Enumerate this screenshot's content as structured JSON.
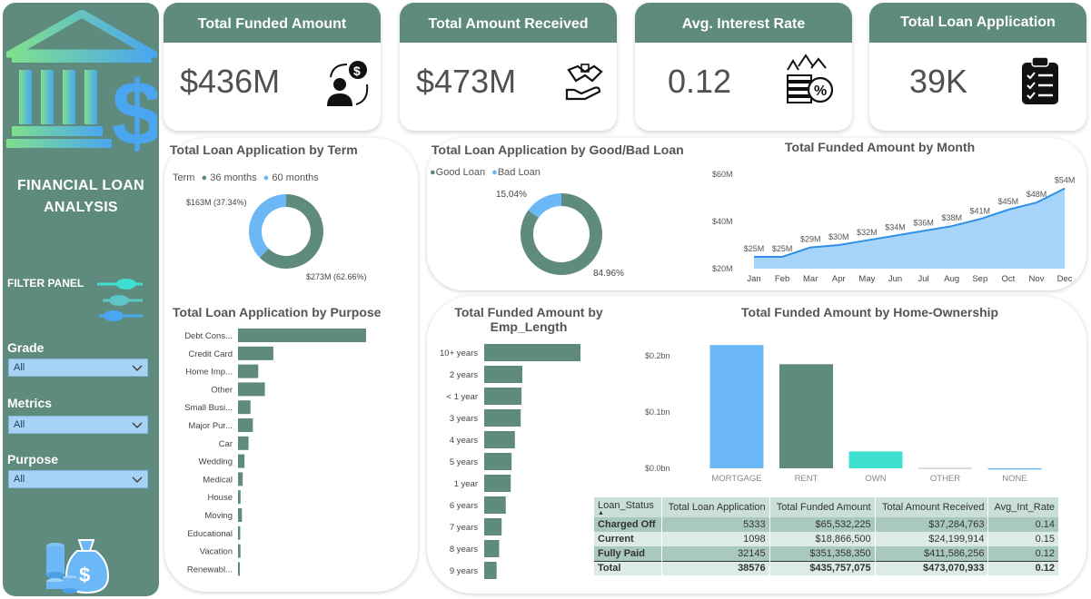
{
  "sidebar": {
    "title_line1": "FINANCIAL LOAN",
    "title_line2": "ANALYSIS",
    "filter_panel": "FILTER PANEL",
    "slicers": [
      {
        "label": "Grade",
        "value": "All"
      },
      {
        "label": "Metrics",
        "value": "All"
      },
      {
        "label": "Purpose",
        "value": "All"
      }
    ]
  },
  "kpis": [
    {
      "title": "Total Funded Amount",
      "value": "$436M",
      "icon": "money-hand-icon"
    },
    {
      "title": "Total Amount Received",
      "value": "$473M",
      "icon": "handshake-icon"
    },
    {
      "title": "Avg. Interest Rate",
      "value": "0.12",
      "icon": "interest-coins-icon"
    },
    {
      "title": "Total Loan Application",
      "value": "39K",
      "icon": "clipboard-checklist-icon"
    }
  ],
  "colors": {
    "teal": "#5f8a7e",
    "blue": "#6cb8f6",
    "turquoise": "#3ee0cf",
    "header": "#5f8a7e"
  },
  "chart_data": [
    {
      "id": "term",
      "type": "pie",
      "title": "Total Loan Application by Term",
      "legend_title": "Term",
      "categories": [
        "36 months",
        "60 months"
      ],
      "values": [
        62.66,
        37.34
      ],
      "labels": [
        "$273M (62.66%)",
        "$163M (37.34%)"
      ]
    },
    {
      "id": "goodbad",
      "type": "pie",
      "title": "Total Loan Application by Good/Bad Loan",
      "categories": [
        "Good Loan",
        "Bad Loan"
      ],
      "values": [
        84.96,
        15.04
      ],
      "labels": [
        "84.96%",
        "15.04%"
      ]
    },
    {
      "id": "month",
      "type": "area",
      "title": "Total Funded Amount by Month",
      "categories": [
        "Jan",
        "Feb",
        "Mar",
        "Apr",
        "May",
        "Jun",
        "Jul",
        "Aug",
        "Sep",
        "Oct",
        "Nov",
        "Dec"
      ],
      "values": [
        25,
        25,
        29,
        30,
        32,
        34,
        36,
        38,
        41,
        45,
        48,
        54
      ],
      "labels": [
        "$25M",
        "$25M",
        "$29M",
        "$30M",
        "$32M",
        "$34M",
        "$36M",
        "$38M",
        "$41M",
        "$45M",
        "$48M",
        "$54M"
      ],
      "yticks": [
        "$20M",
        "$40M",
        "$60M"
      ],
      "ylim": [
        20,
        60
      ]
    },
    {
      "id": "purpose",
      "type": "bar",
      "title": "Total Loan Application by Purpose",
      "categories": [
        "Debt Cons...",
        "Credit Card",
        "Home Imp...",
        "Other",
        "Small Busi...",
        "Major Pur...",
        "Car",
        "Wedding",
        "Medical",
        "House",
        "Moving",
        "Educational",
        "Vacation",
        "Renewabl..."
      ],
      "values": [
        18214,
        5027,
        2876,
        3824,
        1776,
        2110,
        1497,
        928,
        667,
        366,
        559,
        315,
        352,
        94
      ]
    },
    {
      "id": "emp",
      "type": "bar",
      "title_line1": "Total Funded Amount by",
      "title_line2": "Emp_Length",
      "categories": [
        "10+ years",
        "2 years",
        "< 1 year",
        "3 years",
        "4 years",
        "5 years",
        "1 year",
        "6 years",
        "7 years",
        "8 years",
        "9 years"
      ],
      "values": [
        116,
        46,
        45,
        44,
        37,
        33,
        32,
        26,
        21,
        18,
        15
      ]
    },
    {
      "id": "home",
      "type": "bar",
      "title": "Total Funded Amount by Home-Ownership",
      "categories": [
        "MORTGAGE",
        "RENT",
        "OWN",
        "OTHER",
        "NONE"
      ],
      "values": [
        0.219,
        0.185,
        0.03,
        0.001,
        0.0002
      ],
      "yticks": [
        "$0.0bn",
        "$0.1bn",
        "$0.2bn"
      ],
      "ylim": [
        0,
        0.2
      ],
      "colors": [
        "#6cb8f6",
        "#5f8a7e",
        "#3ee0cf",
        "#cfcfcf",
        "#6cb8f6"
      ]
    },
    {
      "id": "status_table",
      "type": "table",
      "columns": [
        "Loan_Status",
        "Total Loan Application",
        "Total Funded Amount",
        "Total Amount Received",
        "Avg_Int_Rate"
      ],
      "rows": [
        [
          "Charged Off",
          "5333",
          "$65,532,225",
          "$37,284,763",
          "0.14"
        ],
        [
          "Current",
          "1098",
          "$18,866,500",
          "$24,199,914",
          "0.15"
        ],
        [
          "Fully Paid",
          "32145",
          "$351,358,350",
          "$411,586,256",
          "0.12"
        ]
      ],
      "total": [
        "Total",
        "38576",
        "$435,757,075",
        "$473,070,933",
        "0.12"
      ]
    }
  ]
}
